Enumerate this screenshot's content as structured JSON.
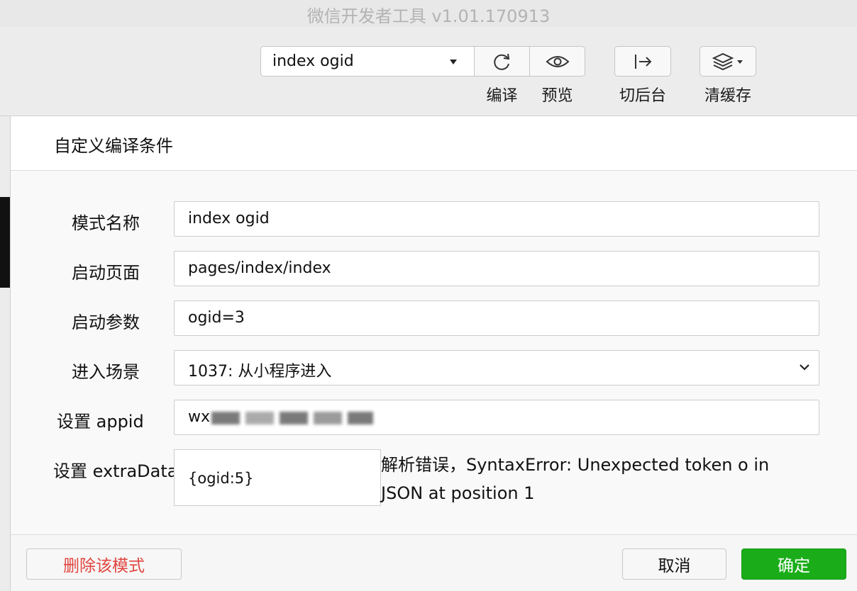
{
  "window": {
    "title": "微信开发者工具 v1.01.170913"
  },
  "toolbar": {
    "mode_select": {
      "value": "index ogid"
    },
    "buttons": [
      {
        "name": "compile",
        "label": "编译",
        "icon": "refresh-icon"
      },
      {
        "name": "preview",
        "label": "预览",
        "icon": "eye-icon"
      },
      {
        "name": "background",
        "label": "切后台",
        "icon": "switch-background-icon"
      },
      {
        "name": "clear-cache",
        "label": "清缓存",
        "icon": "layers-icon"
      }
    ]
  },
  "dialog": {
    "title": "自定义编译条件",
    "fields": {
      "mode_name": {
        "label": "模式名称",
        "value": "index ogid"
      },
      "start_page": {
        "label": "启动页面",
        "value": "pages/index/index"
      },
      "start_params": {
        "label": "启动参数",
        "value": "ogid=3"
      },
      "scene": {
        "label": "进入场景",
        "value": "1037: 从小程序进入"
      },
      "appid": {
        "label": "设置 appid",
        "value_prefix": "wx"
      },
      "extra_data": {
        "label": "设置 extraData",
        "value": "{ogid:5}",
        "error": "解析错误，SyntaxError: Unexpected token o in JSON at position 1"
      }
    },
    "footer": {
      "delete_label": "删除该模式",
      "cancel_label": "取消",
      "ok_label": "确定"
    }
  },
  "colors": {
    "primary_green": "#1aad19",
    "danger_red": "#e0453f"
  }
}
